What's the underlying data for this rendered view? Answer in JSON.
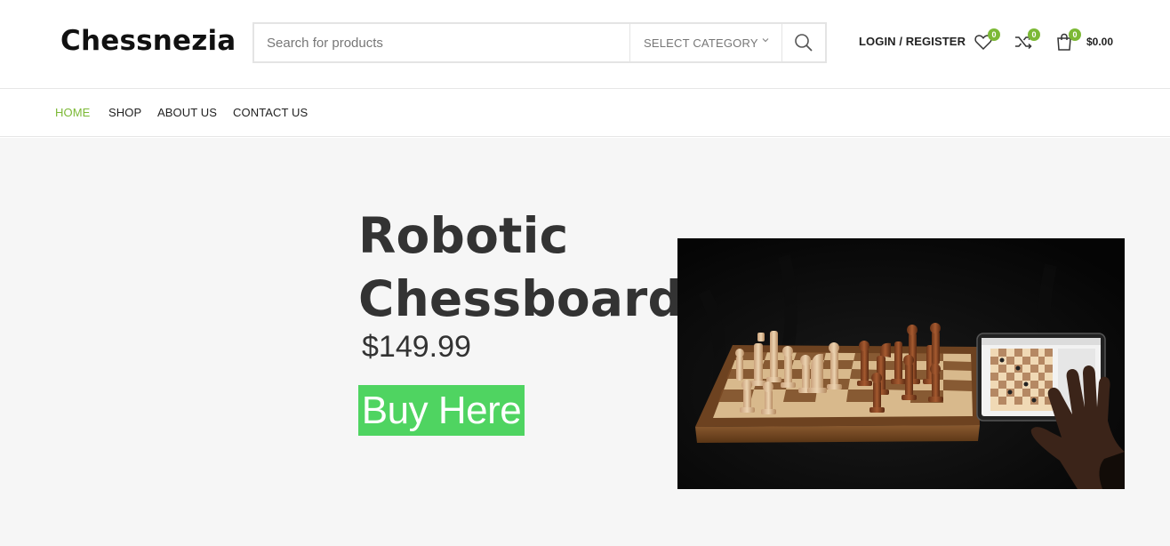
{
  "site": {
    "logo": "Chessnezia"
  },
  "search": {
    "placeholder": "Search for products",
    "category_label": "SELECT CATEGORY"
  },
  "header": {
    "login_label": "LOGIN / REGISTER",
    "wishlist_count": "0",
    "compare_count": "0",
    "cart_count": "0",
    "cart_total": "$0.00"
  },
  "nav": {
    "items": [
      {
        "label": "HOME",
        "active": true
      },
      {
        "label": "SHOP"
      },
      {
        "label": "ABOUT US"
      },
      {
        "label": "CONTACT US"
      }
    ]
  },
  "hero": {
    "title_line1": "Robotic",
    "title_line2": "Chessboard",
    "price": "$149.99",
    "button_label": "Buy Here",
    "image_subject": "wooden robotic chessboard with tablet"
  },
  "colors": {
    "accent": "#7cb936",
    "buy_button": "#4fd461",
    "hero_bg": "#f6f6f6",
    "text": "#333333"
  },
  "icons": [
    "search-icon",
    "chevron-down-icon",
    "heart-icon",
    "shuffle-icon",
    "shopping-bag-icon"
  ]
}
